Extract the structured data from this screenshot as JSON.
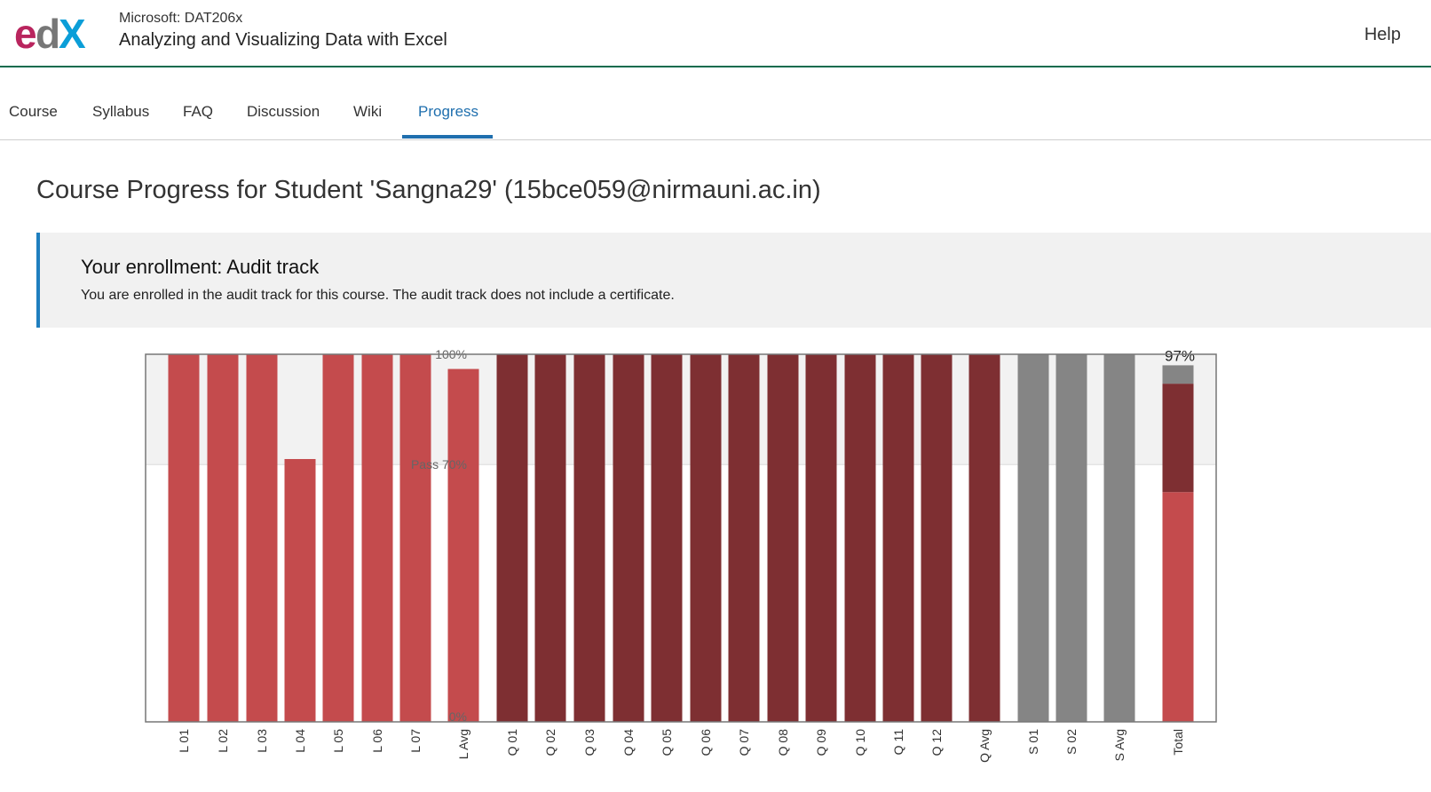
{
  "header": {
    "logo_text": "edX",
    "course_org": "Microsoft: DAT206x",
    "course_title": "Analyzing and Visualizing Data with Excel",
    "help": "Help"
  },
  "tabs": [
    {
      "label": "Course",
      "active": false
    },
    {
      "label": "Syllabus",
      "active": false
    },
    {
      "label": "FAQ",
      "active": false
    },
    {
      "label": "Discussion",
      "active": false
    },
    {
      "label": "Wiki",
      "active": false
    },
    {
      "label": "Progress",
      "active": true
    }
  ],
  "page_title": "Course Progress for Student 'Sangna29' (15bce059@nirmauni.ac.in)",
  "enrollment": {
    "title": "Your enrollment: Audit track",
    "description": "You are enrolled in the audit track for this course. The audit track does not include a certificate."
  },
  "colors": {
    "lab": "#c44b4d",
    "quiz": "#7e2f32",
    "survey": "#858585",
    "accent": "#1f6fae",
    "header_rule": "#0e6b4e"
  },
  "chart_data": {
    "type": "bar",
    "categories": [
      "L 01",
      "L 02",
      "L 03",
      "L 04",
      "L 05",
      "L 06",
      "L 07",
      "L Avg",
      "Q 01",
      "Q 02",
      "Q 03",
      "Q 04",
      "Q 05",
      "Q 06",
      "Q 07",
      "Q 08",
      "Q 09",
      "Q 10",
      "Q 11",
      "Q 12",
      "Q Avg",
      "S 01",
      "S 02",
      "S Avg",
      "Total"
    ],
    "groups": [
      "lab",
      "lab",
      "lab",
      "lab",
      "lab",
      "lab",
      "lab",
      "lab",
      "quiz",
      "quiz",
      "quiz",
      "quiz",
      "quiz",
      "quiz",
      "quiz",
      "quiz",
      "quiz",
      "quiz",
      "quiz",
      "quiz",
      "quiz",
      "survey",
      "survey",
      "survey",
      "total"
    ],
    "values": [
      100,
      100,
      100,
      71.5,
      100,
      100,
      100,
      96,
      100,
      100,
      100,
      100,
      100,
      100,
      100,
      100,
      100,
      100,
      100,
      100,
      100,
      100,
      100,
      100,
      97
    ],
    "total_stack": [
      {
        "group": "lab",
        "value": 62.5
      },
      {
        "group": "quiz",
        "value": 29.5
      },
      {
        "group": "survey",
        "value": 5
      }
    ],
    "total_label": "97%",
    "reference_lines": [
      {
        "value": 100,
        "label": "100%"
      },
      {
        "value": 70,
        "label": "Pass 70%"
      },
      {
        "value": 0,
        "label": "0%"
      }
    ],
    "ylim": [
      0,
      100
    ]
  }
}
